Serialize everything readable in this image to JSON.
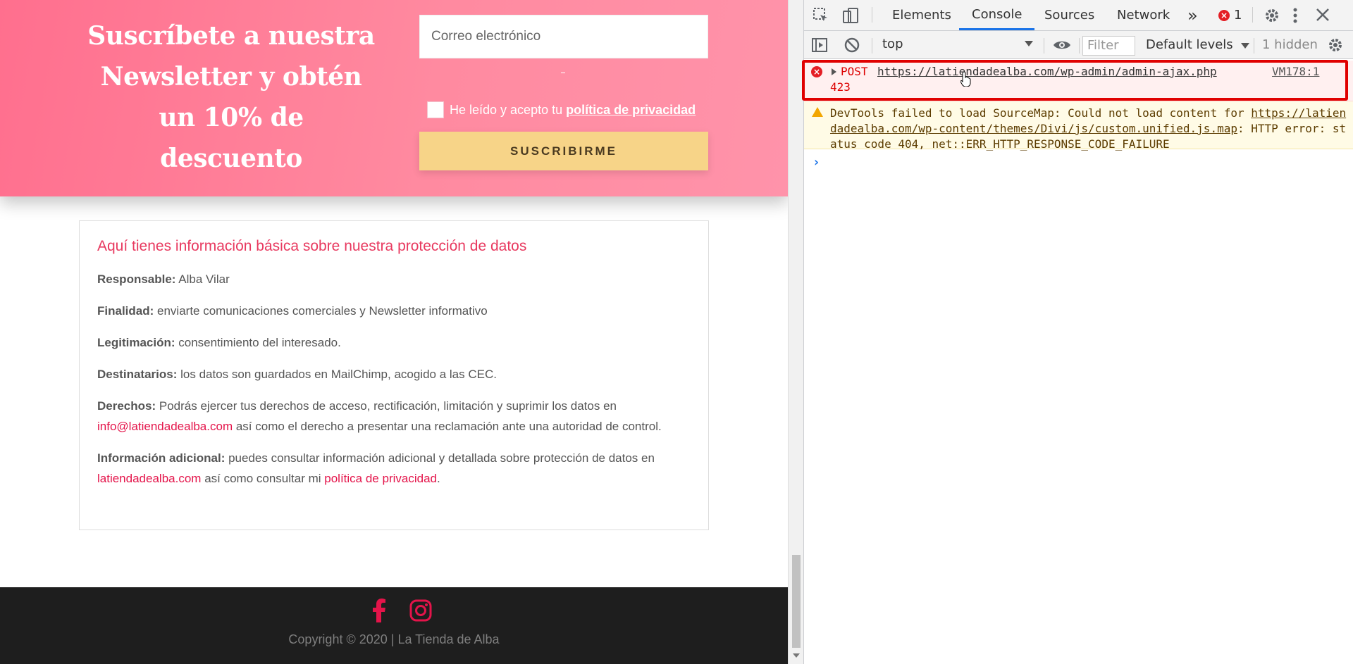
{
  "newsletter": {
    "title": "Suscríbete a nuestra Newsletter y obtén un 10% de descuento",
    "email_placeholder": "Correo electrónico",
    "consent_prefix": "He leído y acepto tu",
    "consent_link": "política de privacidad",
    "submit_label": "SUSCRIBIRME"
  },
  "privacy": {
    "title": "Aquí tienes información básica sobre nuestra protección de datos",
    "responsable_label": "Responsable:",
    "responsable_value": "Alba Vilar",
    "finalidad_label": "Finalidad:",
    "finalidad_value": "enviarte comunicaciones comerciales y Newsletter informativo",
    "legitimacion_label": "Legitimación:",
    "legitimacion_value": "consentimiento del interesado.",
    "destinatarios_label": "Destinatarios:",
    "destinatarios_value": "los datos son guardados en MailChimp, acogido a las CEC.",
    "derechos_label": "Derechos:",
    "derechos_text1": "Podrás ejercer tus derechos de acceso, rectificación, limitación y suprimir los datos en",
    "derechos_email": "info@latiendadealba.com",
    "derechos_text2": "así como el derecho a presentar una reclamación ante una autoridad de control.",
    "info_label": "Información adicional:",
    "info_text1": "puedes consultar información adicional y detallada sobre protección de datos en",
    "info_site": "latiendadealba.com",
    "info_text2": "así como consultar mi",
    "info_policy": "política de privacidad",
    "info_end": "."
  },
  "footer": {
    "copyright": "Copyright © 2020 | La Tienda de Alba",
    "icons": [
      "facebook-icon",
      "instagram-icon"
    ],
    "icon_color": "#e4144a"
  },
  "devtools": {
    "tabs": [
      "Elements",
      "Console",
      "Sources",
      "Network"
    ],
    "active_tab": "Console",
    "more_tabs": "»",
    "error_count": "1",
    "context": "top",
    "filter_placeholder": "Filter",
    "levels": "Default levels",
    "hidden": "1 hidden",
    "error": {
      "method": "POST",
      "url": "https://latiendadealba.com/wp-admin/admin-ajax.php",
      "status": "423",
      "source": "VM178:1"
    },
    "warning": {
      "prefix": "DevTools failed to load SourceMap: Could not load content for",
      "link": "https://latiendadealba.com/wp-content/themes/Divi/js/custom.unified.js.map",
      "suffix": ": HTTP error: status code 404, net::ERR_HTTP_RESPONSE_CODE_FAILURE"
    },
    "prompt": "›",
    "colors": {
      "error": "#dd0000",
      "highlight": "#e00000",
      "accent": "#1a73e8"
    }
  }
}
